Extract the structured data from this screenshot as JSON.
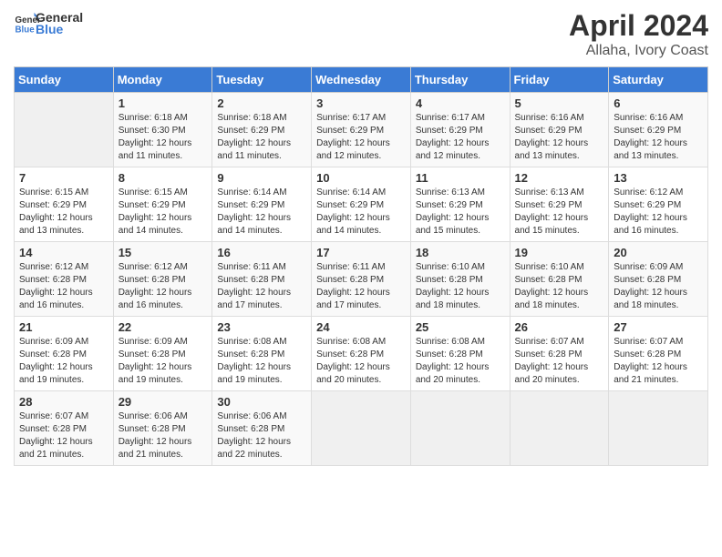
{
  "header": {
    "logo_line1": "General",
    "logo_line2": "Blue",
    "month": "April 2024",
    "location": "Allaha, Ivory Coast"
  },
  "days_of_week": [
    "Sunday",
    "Monday",
    "Tuesday",
    "Wednesday",
    "Thursday",
    "Friday",
    "Saturday"
  ],
  "weeks": [
    [
      {
        "day": "",
        "sunrise": "",
        "sunset": "",
        "daylight": ""
      },
      {
        "day": "1",
        "sunrise": "Sunrise: 6:18 AM",
        "sunset": "Sunset: 6:30 PM",
        "daylight": "Daylight: 12 hours and 11 minutes."
      },
      {
        "day": "2",
        "sunrise": "Sunrise: 6:18 AM",
        "sunset": "Sunset: 6:29 PM",
        "daylight": "Daylight: 12 hours and 11 minutes."
      },
      {
        "day": "3",
        "sunrise": "Sunrise: 6:17 AM",
        "sunset": "Sunset: 6:29 PM",
        "daylight": "Daylight: 12 hours and 12 minutes."
      },
      {
        "day": "4",
        "sunrise": "Sunrise: 6:17 AM",
        "sunset": "Sunset: 6:29 PM",
        "daylight": "Daylight: 12 hours and 12 minutes."
      },
      {
        "day": "5",
        "sunrise": "Sunrise: 6:16 AM",
        "sunset": "Sunset: 6:29 PM",
        "daylight": "Daylight: 12 hours and 13 minutes."
      },
      {
        "day": "6",
        "sunrise": "Sunrise: 6:16 AM",
        "sunset": "Sunset: 6:29 PM",
        "daylight": "Daylight: 12 hours and 13 minutes."
      }
    ],
    [
      {
        "day": "7",
        "sunrise": "Sunrise: 6:15 AM",
        "sunset": "Sunset: 6:29 PM",
        "daylight": "Daylight: 12 hours and 13 minutes."
      },
      {
        "day": "8",
        "sunrise": "Sunrise: 6:15 AM",
        "sunset": "Sunset: 6:29 PM",
        "daylight": "Daylight: 12 hours and 14 minutes."
      },
      {
        "day": "9",
        "sunrise": "Sunrise: 6:14 AM",
        "sunset": "Sunset: 6:29 PM",
        "daylight": "Daylight: 12 hours and 14 minutes."
      },
      {
        "day": "10",
        "sunrise": "Sunrise: 6:14 AM",
        "sunset": "Sunset: 6:29 PM",
        "daylight": "Daylight: 12 hours and 14 minutes."
      },
      {
        "day": "11",
        "sunrise": "Sunrise: 6:13 AM",
        "sunset": "Sunset: 6:29 PM",
        "daylight": "Daylight: 12 hours and 15 minutes."
      },
      {
        "day": "12",
        "sunrise": "Sunrise: 6:13 AM",
        "sunset": "Sunset: 6:29 PM",
        "daylight": "Daylight: 12 hours and 15 minutes."
      },
      {
        "day": "13",
        "sunrise": "Sunrise: 6:12 AM",
        "sunset": "Sunset: 6:29 PM",
        "daylight": "Daylight: 12 hours and 16 minutes."
      }
    ],
    [
      {
        "day": "14",
        "sunrise": "Sunrise: 6:12 AM",
        "sunset": "Sunset: 6:28 PM",
        "daylight": "Daylight: 12 hours and 16 minutes."
      },
      {
        "day": "15",
        "sunrise": "Sunrise: 6:12 AM",
        "sunset": "Sunset: 6:28 PM",
        "daylight": "Daylight: 12 hours and 16 minutes."
      },
      {
        "day": "16",
        "sunrise": "Sunrise: 6:11 AM",
        "sunset": "Sunset: 6:28 PM",
        "daylight": "Daylight: 12 hours and 17 minutes."
      },
      {
        "day": "17",
        "sunrise": "Sunrise: 6:11 AM",
        "sunset": "Sunset: 6:28 PM",
        "daylight": "Daylight: 12 hours and 17 minutes."
      },
      {
        "day": "18",
        "sunrise": "Sunrise: 6:10 AM",
        "sunset": "Sunset: 6:28 PM",
        "daylight": "Daylight: 12 hours and 18 minutes."
      },
      {
        "day": "19",
        "sunrise": "Sunrise: 6:10 AM",
        "sunset": "Sunset: 6:28 PM",
        "daylight": "Daylight: 12 hours and 18 minutes."
      },
      {
        "day": "20",
        "sunrise": "Sunrise: 6:09 AM",
        "sunset": "Sunset: 6:28 PM",
        "daylight": "Daylight: 12 hours and 18 minutes."
      }
    ],
    [
      {
        "day": "21",
        "sunrise": "Sunrise: 6:09 AM",
        "sunset": "Sunset: 6:28 PM",
        "daylight": "Daylight: 12 hours and 19 minutes."
      },
      {
        "day": "22",
        "sunrise": "Sunrise: 6:09 AM",
        "sunset": "Sunset: 6:28 PM",
        "daylight": "Daylight: 12 hours and 19 minutes."
      },
      {
        "day": "23",
        "sunrise": "Sunrise: 6:08 AM",
        "sunset": "Sunset: 6:28 PM",
        "daylight": "Daylight: 12 hours and 19 minutes."
      },
      {
        "day": "24",
        "sunrise": "Sunrise: 6:08 AM",
        "sunset": "Sunset: 6:28 PM",
        "daylight": "Daylight: 12 hours and 20 minutes."
      },
      {
        "day": "25",
        "sunrise": "Sunrise: 6:08 AM",
        "sunset": "Sunset: 6:28 PM",
        "daylight": "Daylight: 12 hours and 20 minutes."
      },
      {
        "day": "26",
        "sunrise": "Sunrise: 6:07 AM",
        "sunset": "Sunset: 6:28 PM",
        "daylight": "Daylight: 12 hours and 20 minutes."
      },
      {
        "day": "27",
        "sunrise": "Sunrise: 6:07 AM",
        "sunset": "Sunset: 6:28 PM",
        "daylight": "Daylight: 12 hours and 21 minutes."
      }
    ],
    [
      {
        "day": "28",
        "sunrise": "Sunrise: 6:07 AM",
        "sunset": "Sunset: 6:28 PM",
        "daylight": "Daylight: 12 hours and 21 minutes."
      },
      {
        "day": "29",
        "sunrise": "Sunrise: 6:06 AM",
        "sunset": "Sunset: 6:28 PM",
        "daylight": "Daylight: 12 hours and 21 minutes."
      },
      {
        "day": "30",
        "sunrise": "Sunrise: 6:06 AM",
        "sunset": "Sunset: 6:28 PM",
        "daylight": "Daylight: 12 hours and 22 minutes."
      },
      {
        "day": "",
        "sunrise": "",
        "sunset": "",
        "daylight": ""
      },
      {
        "day": "",
        "sunrise": "",
        "sunset": "",
        "daylight": ""
      },
      {
        "day": "",
        "sunrise": "",
        "sunset": "",
        "daylight": ""
      },
      {
        "day": "",
        "sunrise": "",
        "sunset": "",
        "daylight": ""
      }
    ]
  ]
}
